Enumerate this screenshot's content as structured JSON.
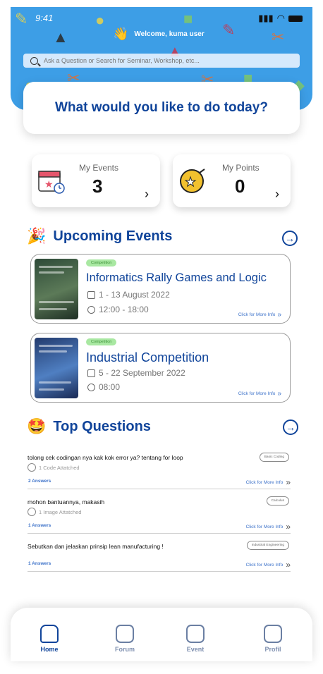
{
  "status": {
    "time": "9:41"
  },
  "header": {
    "welcome": "Welcome, kuma user",
    "search_placeholder": "Ask a Question or Search for Seminar, Workshop, etc..."
  },
  "prompt": "What would you like to do today?",
  "stats": {
    "events_label": "My Events",
    "events_value": "3",
    "points_label": "My Points",
    "points_value": "0"
  },
  "upcoming": {
    "title": "Upcoming Events",
    "events": [
      {
        "tag": "Competition",
        "title": "Informatics Rally Games and Logic",
        "date": "1 - 13 August 2022",
        "time": "12:00 - 18:00",
        "more": "Click for More Info"
      },
      {
        "tag": "Competition",
        "title": "Industrial Competition",
        "date": "5 - 22 September 2022",
        "time": "08:00",
        "more": "Click for More Info"
      }
    ]
  },
  "questions": {
    "title": "Top Questions",
    "items": [
      {
        "text": "tolong cek codingan nya kak kok error ya? tentang for loop",
        "attachment": "1 Code Attatched",
        "tag": "Basic Coding",
        "answers": "2 Answers",
        "more": "Click for More Info"
      },
      {
        "text": "mohon bantuannya, makasih",
        "attachment": "1 Image Attatched",
        "tag": "Calculus",
        "answers": "1 Answers",
        "more": "Click for More Info"
      },
      {
        "text": "Sebutkan dan jelaskan prinsip lean manufacturing !",
        "attachment": "",
        "tag": "Industrial Engineering",
        "answers": "1 Answers",
        "more": "Click for More Info"
      }
    ]
  },
  "nav": {
    "items": [
      {
        "label": "Home",
        "active": true
      },
      {
        "label": "Forum",
        "active": false
      },
      {
        "label": "Event",
        "active": false
      },
      {
        "label": "Profil",
        "active": false
      }
    ]
  },
  "colors": {
    "primary": "#10449a",
    "header_bg": "#3d9ee6",
    "link": "#3d72c9",
    "tag_green": "#a9e8a2"
  }
}
